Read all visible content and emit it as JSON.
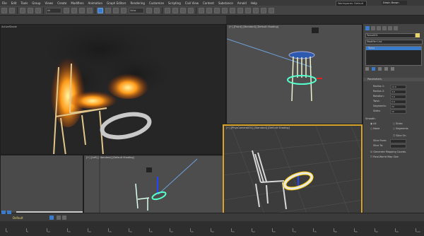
{
  "menu": [
    "File",
    "Edit",
    "Tools",
    "Group",
    "Views",
    "Create",
    "Modifiers",
    "Animation",
    "Graph Editors",
    "Rendering",
    "Customize",
    "Scripting",
    "Civil View",
    "Content",
    "Substance",
    "Arnold",
    "Help"
  ],
  "workspace": "Workspaces: Default",
  "user": "Edwin Brown",
  "toolbar": {
    "filter_dropdown": "All",
    "view_dropdown": "View"
  },
  "render_window": {
    "title": "ActiveShade"
  },
  "viewports": {
    "front_label": "[+] [Front] [Standard] [Default Shading]",
    "left_label": "[+] [Left] [Standard] [Default Shading]",
    "persp_label": "[+] [PhysCamera001] [Standard] [Default Shading]"
  },
  "command_panel": {
    "object_name": "Torus001",
    "modifier_list": "Modifier List",
    "stack_item": "Torus",
    "rollout_title": "Parameters",
    "params": [
      {
        "label": "Radius 1:",
        "value": "12.0"
      },
      {
        "label": "Radius 2:",
        "value": "3.0"
      },
      {
        "label": "Rotation:",
        "value": "0.0"
      },
      {
        "label": "Twist:",
        "value": "0.0"
      },
      {
        "label": "Segments:",
        "value": "24"
      },
      {
        "label": "Sides:",
        "value": "12"
      }
    ],
    "smooth_title": "Smooth:",
    "smooth_options": [
      "All",
      "Sides",
      "None",
      "Segments"
    ],
    "slice_on": "Slice On",
    "slice_from": "Slice From:",
    "slice_to": "Slice To:",
    "gen_mapping": "Generate Mapping Coords.",
    "real_world": "Real-World Map Size"
  },
  "status": {
    "default_label": "Default"
  },
  "timeline": {
    "frames": [
      "0",
      "5",
      "10",
      "15",
      "20",
      "25",
      "30",
      "35",
      "40",
      "45",
      "50",
      "55",
      "60",
      "65",
      "70",
      "75",
      "80",
      "85",
      "90",
      "95",
      "100"
    ]
  }
}
